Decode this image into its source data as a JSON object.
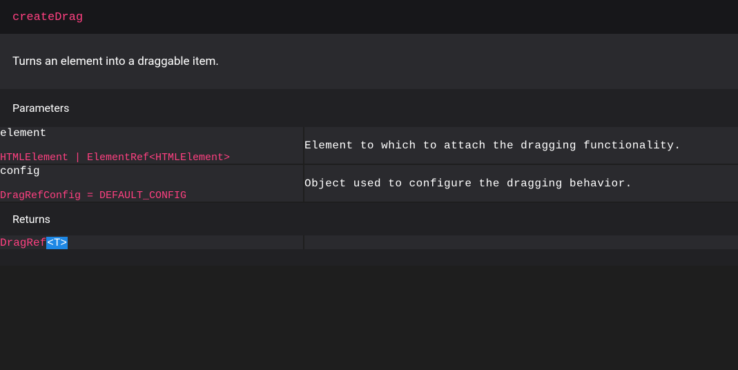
{
  "method": {
    "name": "createDrag",
    "description": "Turns an element into a draggable item."
  },
  "parameters": {
    "header": "Parameters",
    "items": [
      {
        "name": "element",
        "type": "HTMLElement | ElementRef<HTMLElement>",
        "description": "Element to which to attach the dragging functionality."
      },
      {
        "name": "config",
        "type": "DragRefConfig = DEFAULT_CONFIG",
        "description": "Object used to configure the dragging behavior."
      }
    ]
  },
  "returns": {
    "header": "Returns",
    "type_prefix": "DragRef",
    "type_generic": "<T>"
  }
}
